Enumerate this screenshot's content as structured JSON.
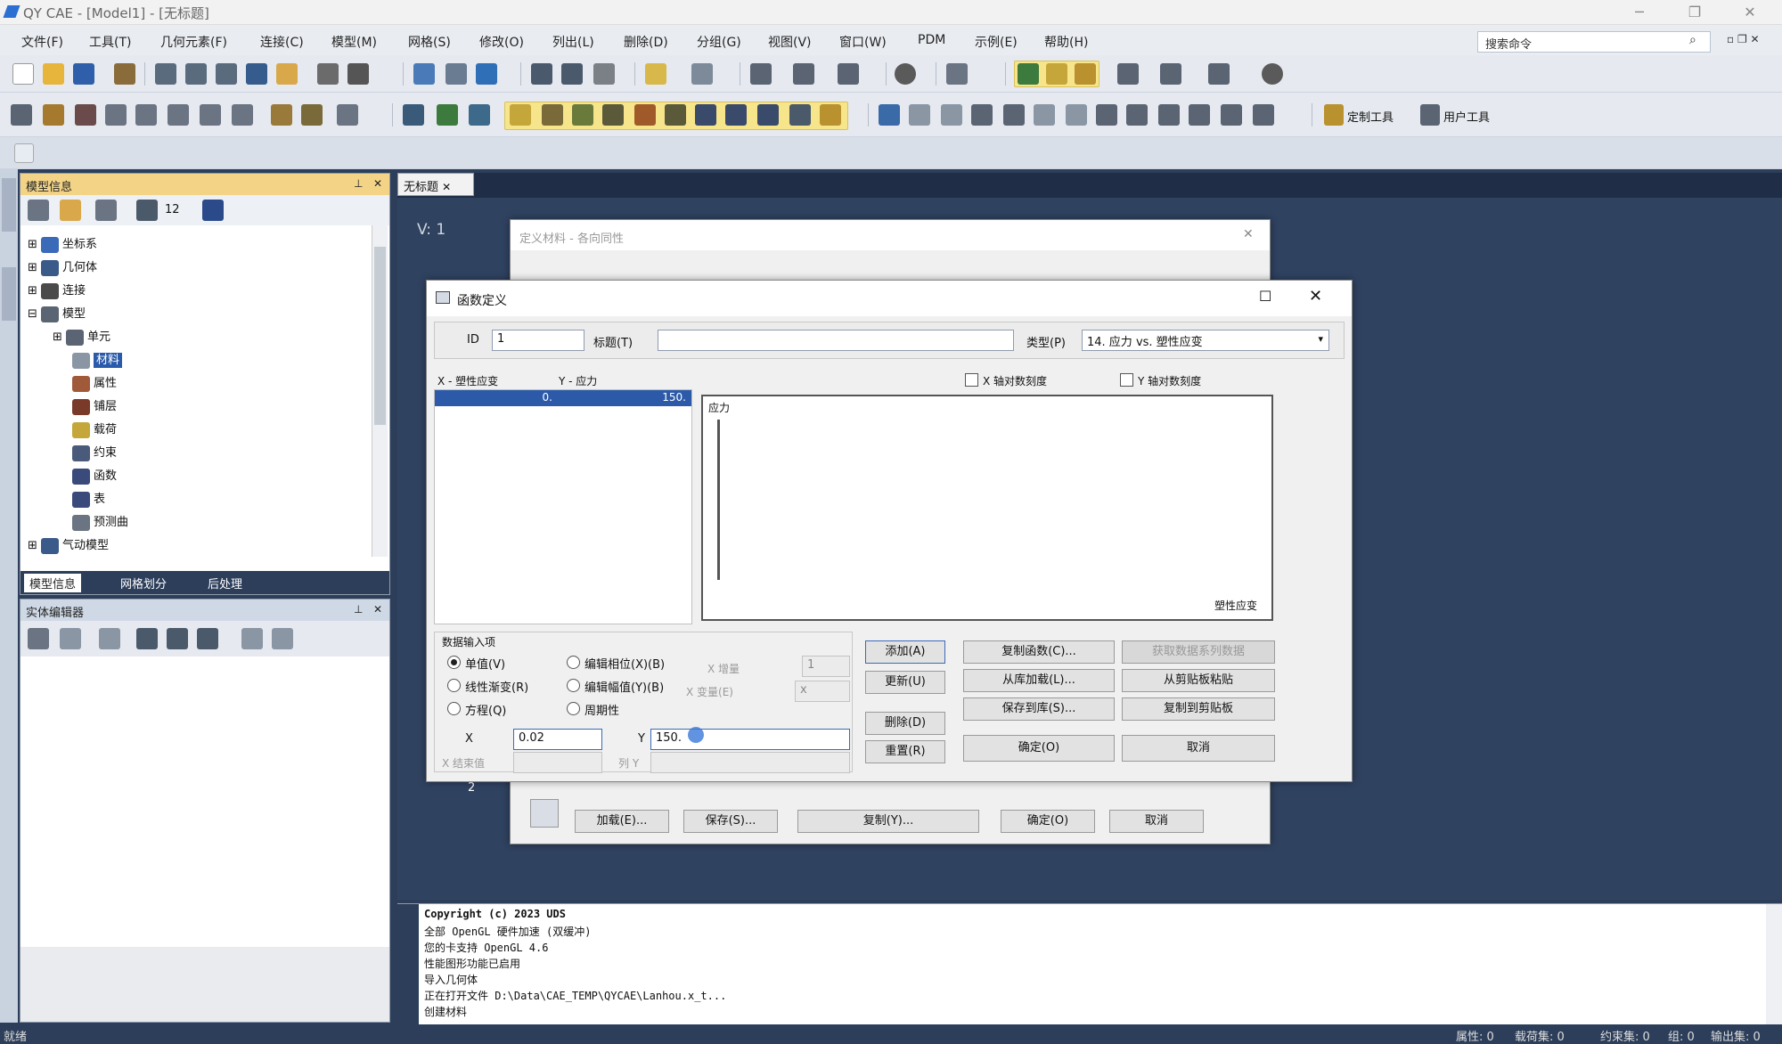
{
  "app": {
    "title": "QY CAE - [Model1] - [无标题]",
    "search_placeholder": "搜索命令"
  },
  "menu": [
    "文件(F)",
    "工具(T)",
    "几何元素(F)",
    "连接(C)",
    "模型(M)",
    "网格(S)",
    "修改(O)",
    "列出(L)",
    "删除(D)",
    "分组(G)",
    "视图(V)",
    "窗口(W)",
    "PDM",
    "示例(E)",
    "帮助(H)"
  ],
  "toolbar": {
    "count_label": "12",
    "custom_tools": "定制工具",
    "user_tools": "用户工具"
  },
  "model_panel": {
    "title": "模型信息",
    "tree": [
      "坐标系",
      "几何体",
      "连接",
      "模型",
      "单元",
      "材料",
      "属性",
      "铺层",
      "载荷",
      "约束",
      "函数",
      "表",
      "预测曲",
      "气动模型"
    ],
    "tabs": [
      "模型信息",
      "网格划分",
      "后处理"
    ]
  },
  "entity_panel": {
    "title": "实体编辑器"
  },
  "doc_tab": "无标题",
  "viewport": {
    "label": "V: 1"
  },
  "material_dialog": {
    "title": "定义材料 - 各向同性",
    "buttons": [
      "加载(E)...",
      "保存(S)...",
      "复制(Y)...",
      "确定(O)",
      "取消"
    ],
    "number_mark": "2"
  },
  "func_dialog": {
    "title": "函数定义",
    "id_label": "ID",
    "id_value": "1",
    "caption_label": "标题(T)",
    "caption_value": "",
    "type_label": "类型(P)",
    "type_value": "14. 应力 vs. 塑性应变",
    "col_x": "X - 塑性应变",
    "col_y": "Y - 应力",
    "row_x": "0.",
    "row_y": "150.",
    "x_log": "X 轴对数刻度",
    "y_log": "Y 轴对数刻度",
    "plot_ylabel": "应力",
    "plot_xlabel": "塑性应变",
    "group_title": "数据输入项",
    "radios": [
      "单值(V)",
      "线性渐变(R)",
      "方程(Q)",
      "编辑相位(X)(B)",
      "编辑幅值(Y)(B)",
      "周期性"
    ],
    "increment_label": "X 增量",
    "increment_value": "1",
    "variable_label": "X 变量(E)",
    "variable_value": "x",
    "x_label": "X",
    "x_value": "0.02",
    "y_label": "Y",
    "y_value": "150.",
    "x_end_label": "X 结束值",
    "y_eq_label": "列 Y",
    "btn_add": "添加(A)",
    "btn_update": "更新(U)",
    "btn_delete": "删除(D)",
    "btn_reset": "重置(R)",
    "btn_copy_func": "复制函数(C)...",
    "btn_get_series": "获取数据系列数据",
    "btn_load_lib": "从库加载(L)...",
    "btn_paste": "从剪贴板粘贴",
    "btn_save_lib": "保存到库(S)...",
    "btn_copy_clip": "复制到剪贴板",
    "btn_ok": "确定(O)",
    "btn_cancel": "取消"
  },
  "console": {
    "lines": [
      "Copyright (c) 2023 UDS",
      "全部 OpenGL 硬件加速 (双缓冲)",
      "您的卡支持 OpenGL 4.6",
      "性能图形功能已启用",
      "导入几何体",
      "正在打开文件 D:\\Data\\CAE_TEMP\\QYCAE\\Lanhou.x_t...",
      "创建材料"
    ]
  },
  "status": {
    "left": "就绪",
    "props": "属性: 0",
    "loadsets": "载荷集: 0",
    "constraints": "约束集: 0",
    "groups": "组: 0",
    "outputs": "输出集: 0"
  }
}
